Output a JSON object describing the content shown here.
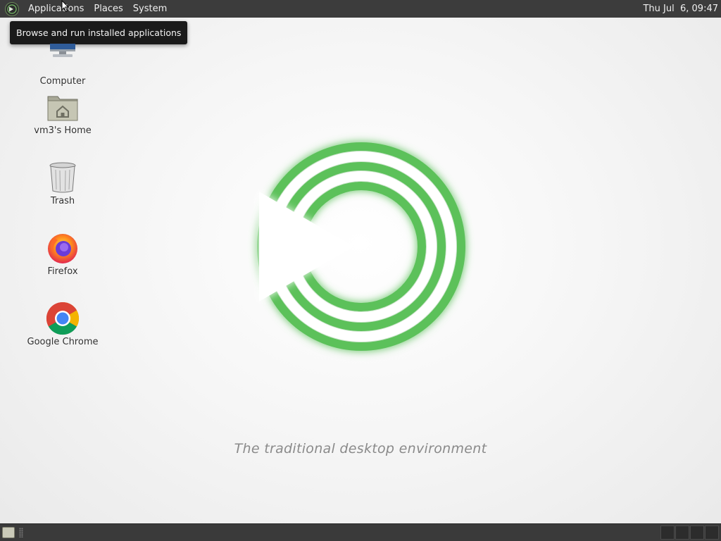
{
  "top_panel": {
    "menus": [
      "Applications",
      "Places",
      "System"
    ],
    "clock": "Thu Jul  6, 09:47"
  },
  "tooltip": {
    "text": "Browse and run installed applications"
  },
  "desktop": {
    "icons": [
      {
        "label": "Computer",
        "icon": "computer-icon"
      },
      {
        "label": "vm3's Home",
        "icon": "home-folder-icon"
      },
      {
        "label": "Trash",
        "icon": "trash-icon"
      },
      {
        "label": "Firefox",
        "icon": "firefox-icon"
      },
      {
        "label": "Google Chrome",
        "icon": "chrome-icon"
      }
    ]
  },
  "wallpaper": {
    "tagline": "The traditional desktop environment",
    "accent_color": "#5cc15a"
  },
  "bottom_panel": {
    "workspaces": 4
  }
}
